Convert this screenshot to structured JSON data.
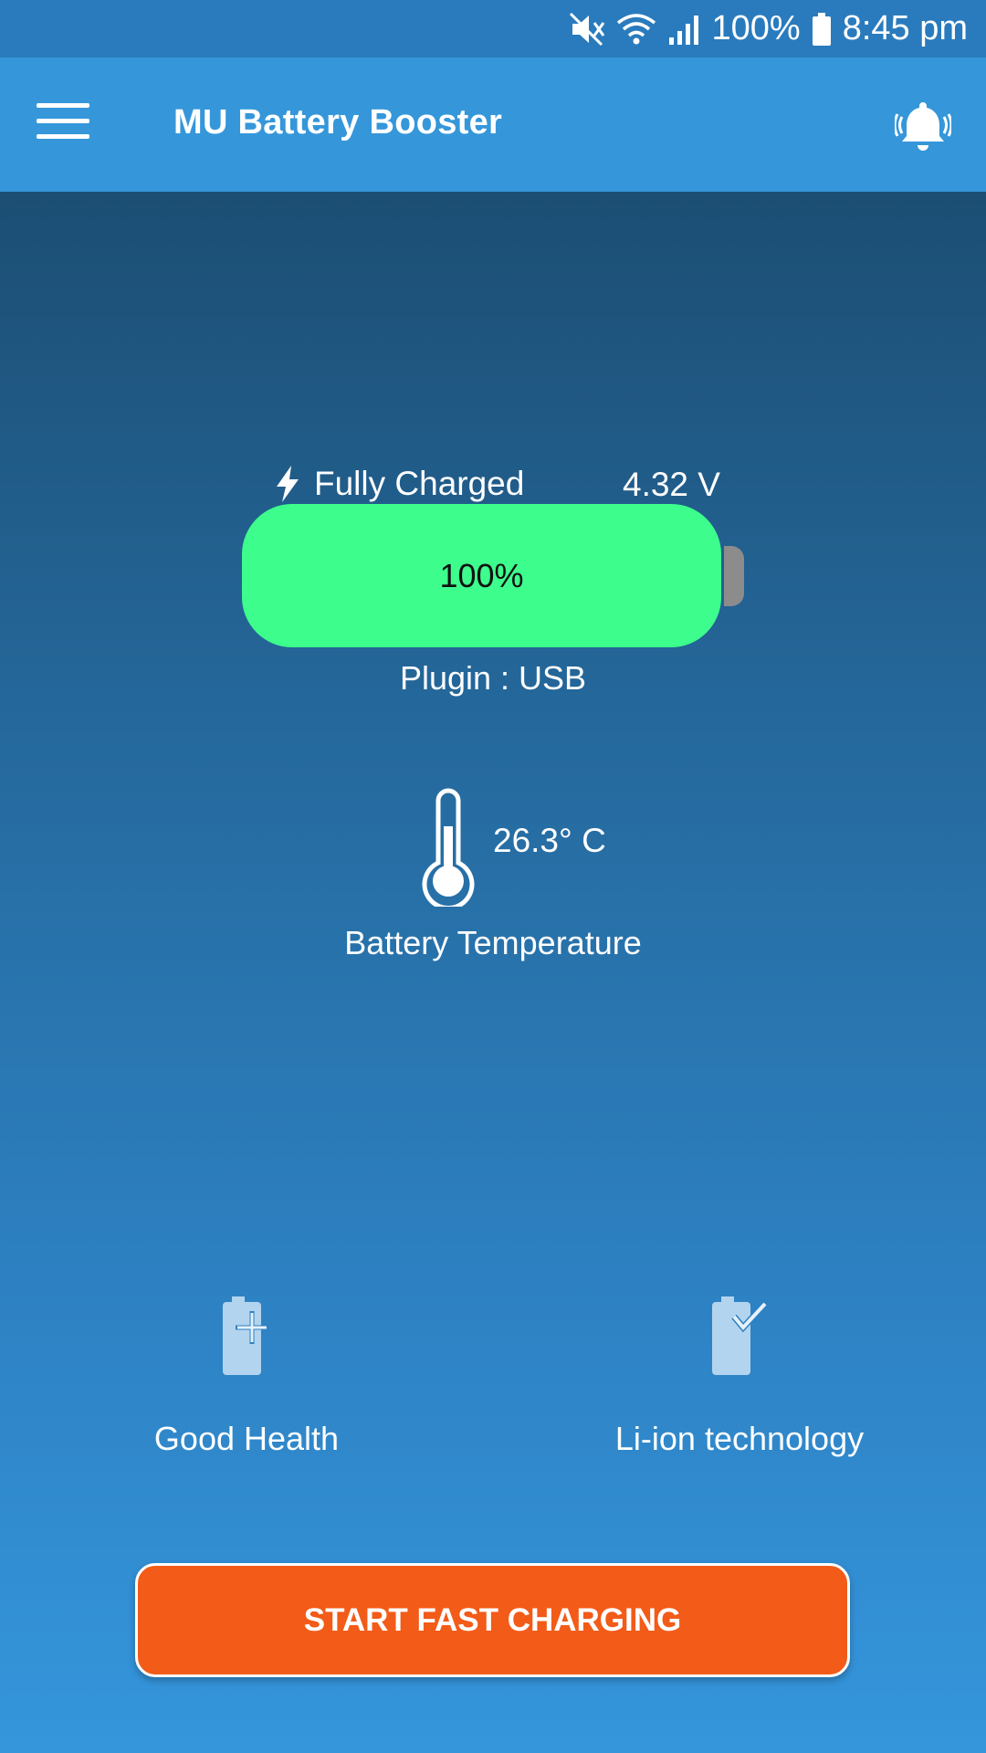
{
  "status_bar": {
    "battery_percent": "100%",
    "time": "8:45 pm",
    "icons": [
      "mute-icon",
      "wifi-icon",
      "signal-icon",
      "battery-icon"
    ]
  },
  "app_bar": {
    "title": "MU Battery Booster",
    "menu_icon": "hamburger-menu-icon",
    "action_icon": "ringing-bell-icon"
  },
  "battery": {
    "status": "Fully Charged",
    "voltage": "4.32 V",
    "level_label": "100%",
    "level_fraction": 1.0,
    "plugin": "Plugin : USB"
  },
  "temperature": {
    "value": "26.3° C",
    "label": "Battery Temperature"
  },
  "features": {
    "health": {
      "label": "Good Health",
      "icon": "battery-plus-icon"
    },
    "technology": {
      "label": "Li-ion technology",
      "icon": "battery-check-icon"
    }
  },
  "cta": {
    "label": "START FAST CHARGING"
  },
  "colors": {
    "battery_fill": "#3dfd8d",
    "cta_background": "#f25b18",
    "app_bar": "#3597da"
  }
}
